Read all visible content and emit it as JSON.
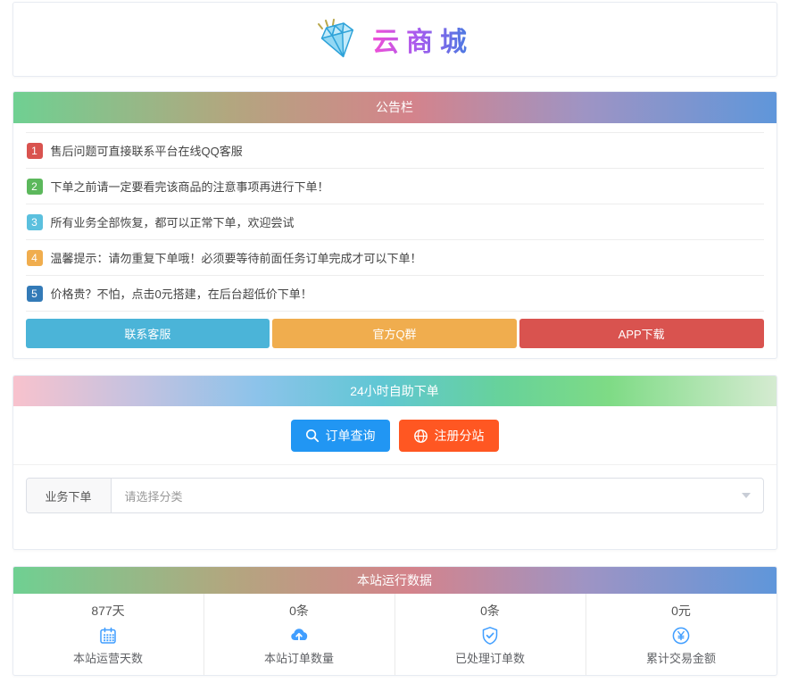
{
  "logo": {
    "text": "云商城"
  },
  "notice_board": {
    "title": "公告栏",
    "items": [
      {
        "num": "1",
        "color": "#d9534f",
        "text": "售后问题可直接联系平台在线QQ客服"
      },
      {
        "num": "2",
        "color": "#5cb85c",
        "text": "下单之前请一定要看完该商品的注意事项再进行下单！"
      },
      {
        "num": "3",
        "color": "#5bc0de",
        "text": "所有业务全部恢复，都可以正常下单，欢迎尝试"
      },
      {
        "num": "4",
        "color": "#f0ad4e",
        "text": "温馨提示：请勿重复下单哦！必须要等待前面任务订单完成才可以下单！"
      },
      {
        "num": "5",
        "color": "#337ab7",
        "text": "价格贵？不怕，点击0元搭建，在后台超低价下单！"
      }
    ],
    "buttons": [
      {
        "label": "联系客服",
        "color": "#4bb4d8"
      },
      {
        "label": "官方Q群",
        "color": "#f0ad4e"
      },
      {
        "label": "APP下载",
        "color": "#d9534f"
      }
    ]
  },
  "order_section": {
    "title": "24小时自助下单",
    "query_button": {
      "label": "订单查询",
      "color": "#2196f3"
    },
    "register_button": {
      "label": "注册分站",
      "color": "#ff5722"
    },
    "form": {
      "label": "业务下单",
      "placeholder": "请选择分类"
    }
  },
  "stats_section": {
    "title": "本站运行数据",
    "icon_color": "#409eff",
    "items": [
      {
        "value": "877天",
        "icon": "calendar-icon",
        "label": "本站运营天数"
      },
      {
        "value": "0条",
        "icon": "cloud-upload-icon",
        "label": "本站订单数量"
      },
      {
        "value": "0条",
        "icon": "shield-check-icon",
        "label": "已处理订单数"
      },
      {
        "value": "0元",
        "icon": "yen-circle-icon",
        "label": "累计交易金额"
      }
    ]
  }
}
